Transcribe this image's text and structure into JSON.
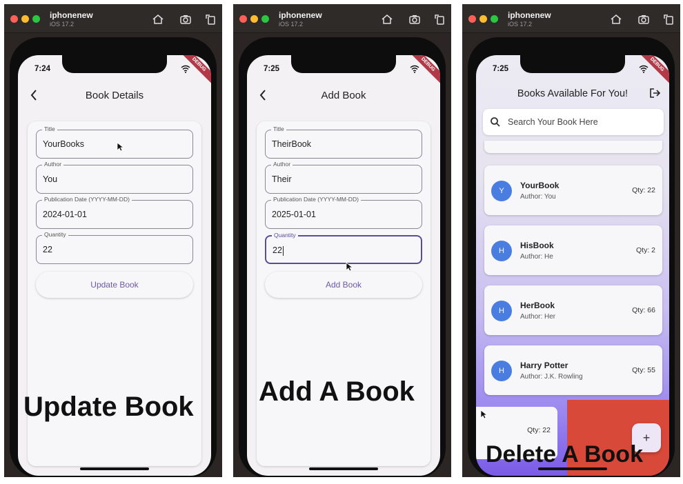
{
  "simulator": {
    "device_name": "iphonenew",
    "os_version": "iOS 17.2"
  },
  "panels": [
    {
      "time": "7:24",
      "debug_label": "DEBUG",
      "nav_title": "Book Details",
      "fields": [
        {
          "label": "Title",
          "value": "YourBooks"
        },
        {
          "label": "Author",
          "value": "You"
        },
        {
          "label": "Publication Date (YYYY-MM-DD)",
          "value": "2024-01-01"
        },
        {
          "label": "Quantity",
          "value": "22"
        }
      ],
      "button_label": "Update Book",
      "caption": "Update Book"
    },
    {
      "time": "7:25",
      "debug_label": "DEBUG",
      "nav_title": "Add Book",
      "fields": [
        {
          "label": "Title",
          "value": "TheirBook"
        },
        {
          "label": "Author",
          "value": "Their"
        },
        {
          "label": "Publication Date (YYYY-MM-DD)",
          "value": "2025-01-01"
        },
        {
          "label": "Quantity",
          "value": "22"
        }
      ],
      "button_label": "Add Book",
      "caption": "Add A Book"
    },
    {
      "time": "7:25",
      "debug_label": "DEBUG",
      "nav_title": "Books Available For You!",
      "search_placeholder": "Search Your Book Here",
      "books": [
        {
          "initial": "Y",
          "title": "YourBook",
          "author": "Author: You",
          "qty": "Qty: 22"
        },
        {
          "initial": "H",
          "title": "HisBook",
          "author": "Author: He",
          "qty": "Qty: 2"
        },
        {
          "initial": "H",
          "title": "HerBook",
          "author": "Author: Her",
          "qty": "Qty: 66"
        },
        {
          "initial": "H",
          "title": "Harry Potter",
          "author": "Author: J.K. Rowling",
          "qty": "Qty: 55"
        }
      ],
      "swiped_qty": "Qty: 22",
      "fab_label": "+",
      "caption": "Delete A Book"
    }
  ],
  "colors": {
    "avatar": "#4a7de0",
    "delete_bg": "#d9493a",
    "accent": "#6b5aa8"
  }
}
